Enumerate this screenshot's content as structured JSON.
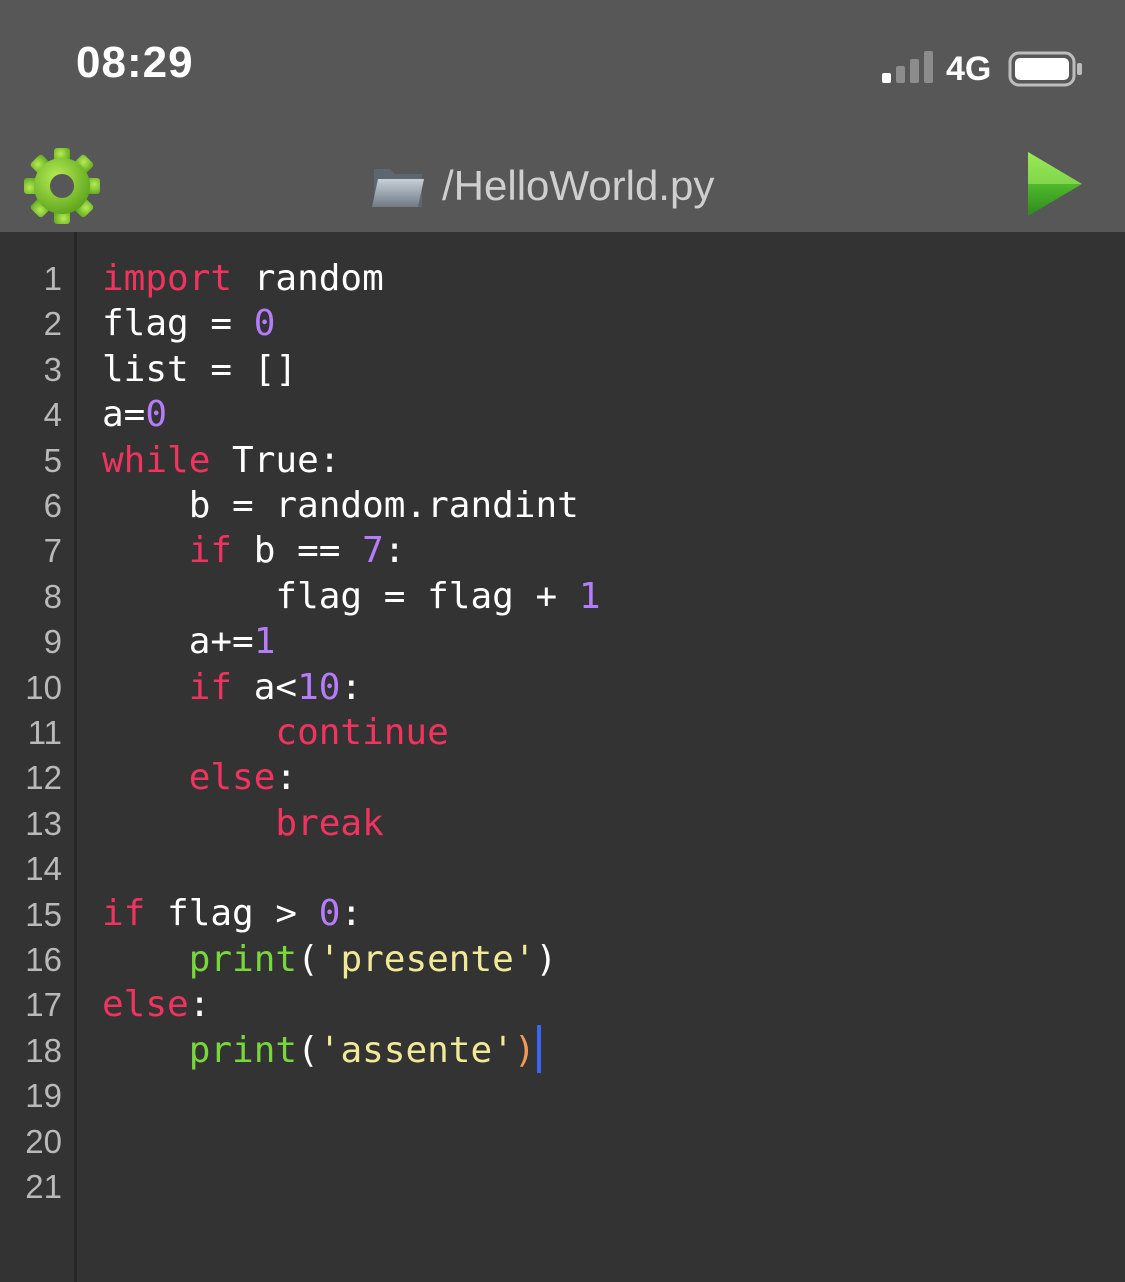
{
  "status_bar": {
    "time": "08:29",
    "network": "4G"
  },
  "toolbar": {
    "file_title": "/HelloWorld.py",
    "settings_icon": "gear-icon",
    "folder_icon": "folder-icon",
    "run_icon": "play-icon"
  },
  "colors": {
    "keyword": "#f0335f",
    "number": "#b57cfb",
    "builtin": "#78d73a",
    "string": "#f0e996",
    "cursor": "#3b66f5"
  },
  "editor": {
    "line_numbers": [
      "1",
      "2",
      "3",
      "4",
      "5",
      "6",
      "7",
      "8",
      "9",
      "10",
      "11",
      "12",
      "13",
      "14",
      "15",
      "16",
      "17",
      "18",
      "19",
      "20",
      "21"
    ],
    "lines": [
      [
        {
          "t": "import",
          "c": "kw"
        },
        {
          "t": " random",
          "c": ""
        }
      ],
      [
        {
          "t": "flag = ",
          "c": ""
        },
        {
          "t": "0",
          "c": "num"
        }
      ],
      [
        {
          "t": "list = []",
          "c": ""
        }
      ],
      [
        {
          "t": "a=",
          "c": ""
        },
        {
          "t": "0",
          "c": "num"
        }
      ],
      [
        {
          "t": "while",
          "c": "kw"
        },
        {
          "t": " True:",
          "c": ""
        }
      ],
      [
        {
          "t": "    b = random.randint",
          "c": ""
        }
      ],
      [
        {
          "t": "    ",
          "c": ""
        },
        {
          "t": "if",
          "c": "kw"
        },
        {
          "t": " b == ",
          "c": ""
        },
        {
          "t": "7",
          "c": "num"
        },
        {
          "t": ":",
          "c": ""
        }
      ],
      [
        {
          "t": "        flag = flag + ",
          "c": ""
        },
        {
          "t": "1",
          "c": "num"
        }
      ],
      [
        {
          "t": "    a+=",
          "c": ""
        },
        {
          "t": "1",
          "c": "num"
        }
      ],
      [
        {
          "t": "    ",
          "c": ""
        },
        {
          "t": "if",
          "c": "kw"
        },
        {
          "t": " a<",
          "c": ""
        },
        {
          "t": "10",
          "c": "num"
        },
        {
          "t": ":",
          "c": ""
        }
      ],
      [
        {
          "t": "        ",
          "c": ""
        },
        {
          "t": "continue",
          "c": "kw"
        }
      ],
      [
        {
          "t": "    ",
          "c": ""
        },
        {
          "t": "else",
          "c": "kw"
        },
        {
          "t": ":",
          "c": ""
        }
      ],
      [
        {
          "t": "        ",
          "c": ""
        },
        {
          "t": "break",
          "c": "kw"
        }
      ],
      [],
      [
        {
          "t": "if",
          "c": "kw"
        },
        {
          "t": " flag > ",
          "c": ""
        },
        {
          "t": "0",
          "c": "num"
        },
        {
          "t": ":",
          "c": ""
        }
      ],
      [
        {
          "t": "    ",
          "c": ""
        },
        {
          "t": "print",
          "c": "fn"
        },
        {
          "t": "(",
          "c": ""
        },
        {
          "t": "'presente'",
          "c": "str"
        },
        {
          "t": ")",
          "c": ""
        }
      ],
      [
        {
          "t": "else",
          "c": "kw"
        },
        {
          "t": ":",
          "c": ""
        }
      ],
      [
        {
          "t": "    ",
          "c": ""
        },
        {
          "t": "print",
          "c": "fn"
        },
        {
          "t": "(",
          "c": ""
        },
        {
          "t": "'assente'",
          "c": "str"
        },
        {
          "t": ")",
          "c": "paren-hl"
        },
        {
          "t": "",
          "c": "cursor"
        }
      ],
      [],
      [],
      []
    ]
  }
}
